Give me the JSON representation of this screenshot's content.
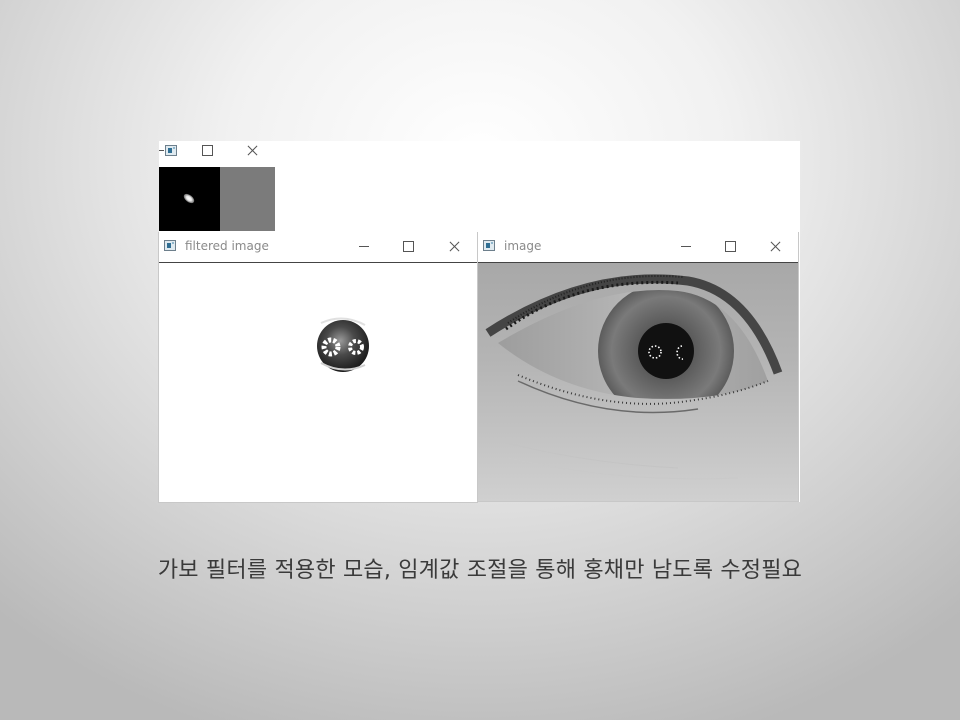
{
  "kernel_window": {
    "title": ""
  },
  "filtered_window": {
    "title": "filtered image"
  },
  "image_window": {
    "title": "image"
  },
  "caption": "가보 필터를 적용한 모습, 임계값 조절을 통해 홍채만 남도록 수정필요",
  "colors": {
    "window_bg": "#ffffff",
    "title_text": "#8a8a8a",
    "caption_text": "#3a3a3a",
    "kernel_imag_gray": "#7b7b7b",
    "pupil": "#111111"
  }
}
